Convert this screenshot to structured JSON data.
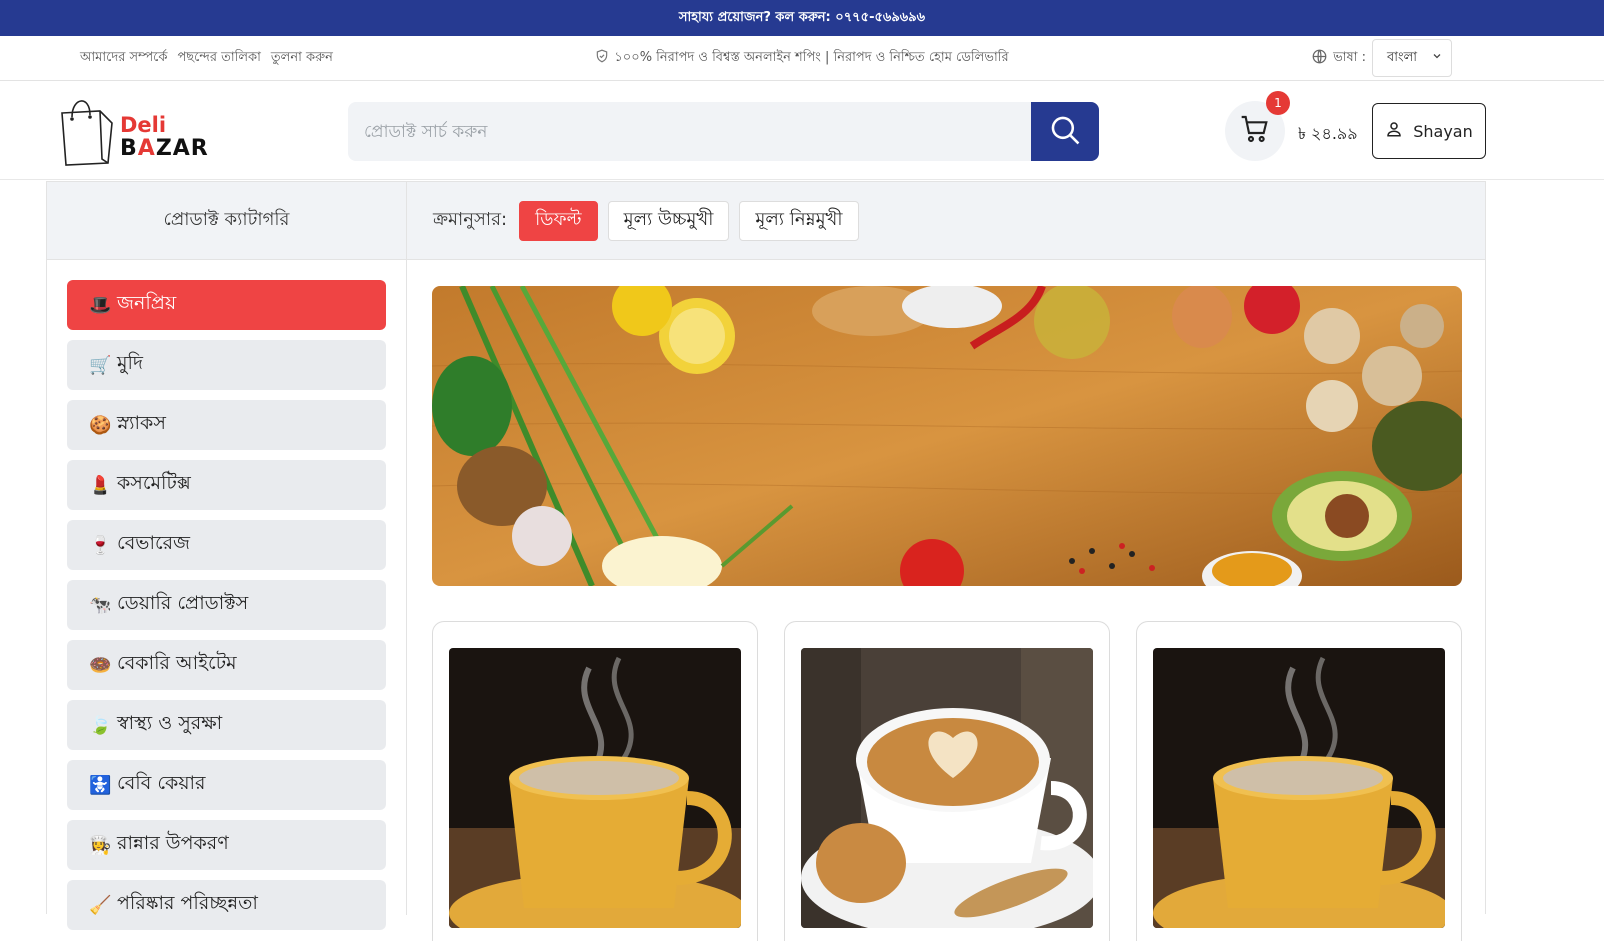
{
  "topbar": {
    "help_text": "সাহায্য প্রয়োজন? কল করুন: ০৭৭৫-৫৬৯৬৯৬"
  },
  "infobar": {
    "links": [
      "আমাদের সম্পর্কে",
      "পছন্দের তালিকা",
      "তুলনা করুন"
    ],
    "notice": "১০০% নিরাপদ ও বিশ্বস্ত অনলাইন শপিং | নিরাপদ ও নিশ্চিত হোম ডেলিভারি",
    "language_label": "ভাষা :",
    "language_selected": "বাংলা"
  },
  "header": {
    "logo": {
      "line1": "Deli",
      "line2_pre": "B",
      "line2_accent": "A",
      "line2_post": "ZAR"
    },
    "search_placeholder": "প্রোডাক্ট সার্চ করুন",
    "cart_count": "1",
    "cart_total": "৳ ২৪.৯৯",
    "account_name": "Shayan"
  },
  "sidebar": {
    "title": "প্রোডাক্ট ক্যাটাগরি",
    "items": [
      {
        "icon": "🎩",
        "label": "জনপ্রিয়"
      },
      {
        "icon": "🛒",
        "label": "মুদি"
      },
      {
        "icon": "🍪",
        "label": "স্ন্যাকস"
      },
      {
        "icon": "💄",
        "label": "কসমেটিক্স"
      },
      {
        "icon": "🍷",
        "label": "বেভারেজ"
      },
      {
        "icon": "🐄",
        "label": "ডেয়ারি প্রোডাক্টস"
      },
      {
        "icon": "🍩",
        "label": "বেকারি আইটেম"
      },
      {
        "icon": "🍃",
        "label": "স্বাস্থ্য ও সুরক্ষা"
      },
      {
        "icon": "🚼",
        "label": "বেবি কেয়ার"
      },
      {
        "icon": "👩‍🍳",
        "label": "রান্নার উপকরণ"
      },
      {
        "icon": "🧹",
        "label": "পরিষ্কার পরিচ্ছন্নতা"
      }
    ]
  },
  "sort": {
    "label": "ক্রমানুসার:",
    "options": [
      "ডিফল্ট",
      "মূল্য উচ্চমুখী",
      "মূল্য নিম্নমুখী"
    ]
  },
  "colors": {
    "primary": "#263a91",
    "accent": "#ef4444"
  }
}
